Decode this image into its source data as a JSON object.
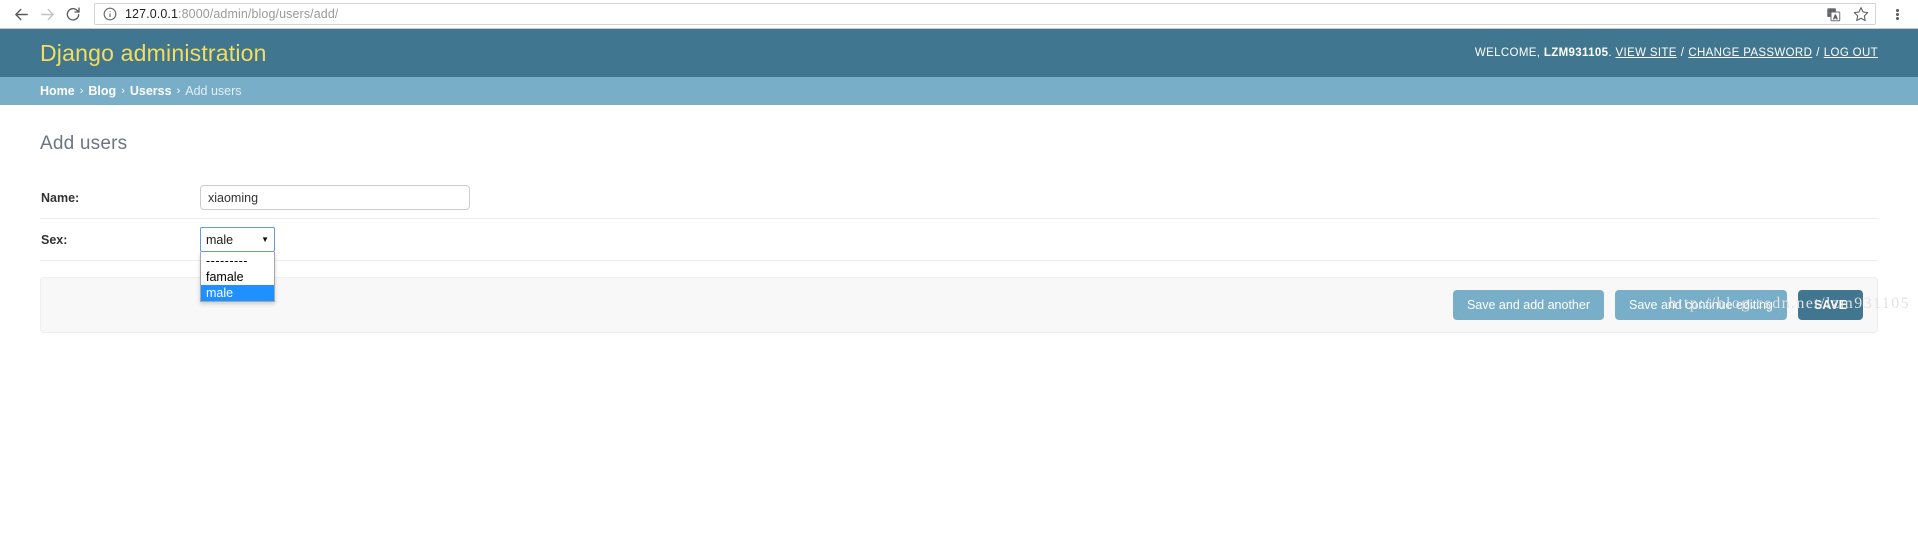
{
  "browser": {
    "back_icon": "arrow-left-icon",
    "forward_icon": "arrow-right-icon",
    "reload_icon": "reload-icon",
    "info_icon": "info-circle-icon",
    "url_host": "127.0.0.1",
    "url_rest": ":8000/admin/blog/users/add/",
    "translate_icon": "translate-icon",
    "bookmark_icon": "star-icon",
    "menu_icon": "three-dots-menu-icon"
  },
  "header": {
    "branding": "Django administration",
    "welcome_prefix": "WELCOME,",
    "username": "LZM931105",
    "username_suffix": ".",
    "links": [
      {
        "label": "VIEW SITE"
      },
      {
        "label": "CHANGE PASSWORD"
      },
      {
        "label": "LOG OUT"
      }
    ],
    "separator": "/"
  },
  "breadcrumbs": {
    "items": [
      {
        "label": "Home",
        "current": false
      },
      {
        "label": "Blog",
        "current": false
      },
      {
        "label": "Userss",
        "current": false
      },
      {
        "label": "Add users",
        "current": true
      }
    ],
    "chevron": "›"
  },
  "main": {
    "page_title": "Add users",
    "fields": [
      {
        "label": "Name:",
        "value": "xiaoming",
        "placeholder": ""
      },
      {
        "label": "Sex:",
        "value": "male"
      }
    ],
    "sex_select": {
      "selected": "male",
      "caret": "▼",
      "options": [
        {
          "label": "---------",
          "selected": false
        },
        {
          "label": "famale",
          "selected": false
        },
        {
          "label": "male",
          "selected": true
        }
      ]
    },
    "buttons": [
      {
        "label": "Save and add another",
        "style": "secondary"
      },
      {
        "label": "Save and continue editing",
        "style": "secondary"
      },
      {
        "label": "SAVE",
        "style": "default"
      }
    ]
  },
  "watermark": {
    "text": "http://blog.csdn.net/lzm931105"
  },
  "colors": {
    "header_bg": "#417690",
    "breadcrumb_bg": "#79aec8",
    "branding_text": "#f5dd5d",
    "button_secondary": "#79aec8",
    "button_default": "#417690",
    "option_highlight": "#1e90ff"
  }
}
